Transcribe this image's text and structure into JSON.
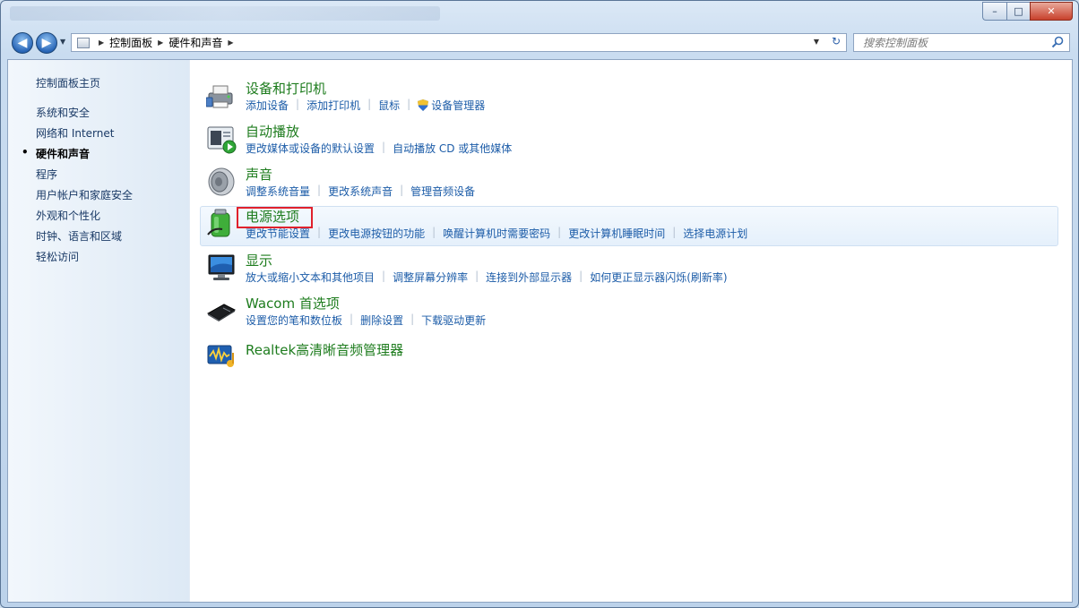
{
  "window": {
    "caption": {
      "minimize": "–",
      "maximize": "□",
      "close": "✕"
    }
  },
  "address": {
    "breadcrumbs": [
      "控制面板",
      "硬件和声音"
    ],
    "search_placeholder": "搜索控制面板"
  },
  "sidebar": {
    "items": [
      {
        "label": "控制面板主页",
        "active": false
      },
      {
        "label": "系统和安全",
        "active": false
      },
      {
        "label": "网络和 Internet",
        "active": false
      },
      {
        "label": "硬件和声音",
        "active": true
      },
      {
        "label": "程序",
        "active": false
      },
      {
        "label": "用户帐户和家庭安全",
        "active": false
      },
      {
        "label": "外观和个性化",
        "active": false
      },
      {
        "label": "时钟、语言和区域",
        "active": false
      },
      {
        "label": "轻松访问",
        "active": false
      }
    ]
  },
  "categories": [
    {
      "title": "设备和打印机",
      "icon": "printer-icon",
      "links": [
        "添加设备",
        "添加打印机",
        "鼠标",
        "设备管理器"
      ]
    },
    {
      "title": "自动播放",
      "icon": "autoplay-icon",
      "links": [
        "更改媒体或设备的默认设置",
        "自动播放 CD 或其他媒体"
      ]
    },
    {
      "title": "声音",
      "icon": "speaker-icon",
      "links": [
        "调整系统音量",
        "更改系统声音",
        "管理音频设备"
      ]
    },
    {
      "title": "电源选项",
      "icon": "battery-icon",
      "links": [
        "更改节能设置",
        "更改电源按钮的功能",
        "唤醒计算机时需要密码",
        "更改计算机睡眠时间",
        "选择电源计划"
      ]
    },
    {
      "title": "显示",
      "icon": "monitor-icon",
      "links": [
        "放大或缩小文本和其他项目",
        "调整屏幕分辨率",
        "连接到外部显示器",
        "如何更正显示器闪烁(刷新率)"
      ]
    },
    {
      "title": "Wacom 首选项",
      "icon": "tablet-icon",
      "links": [
        "设置您的笔和数位板",
        "删除设置",
        "下载驱动更新"
      ]
    },
    {
      "title": "Realtek高清晰音频管理器",
      "icon": "audio-manager-icon",
      "links": []
    }
  ],
  "colors": {
    "category_title": "#1e7c1e",
    "link": "#1c5ca8",
    "highlight_box": "#e0212c"
  }
}
